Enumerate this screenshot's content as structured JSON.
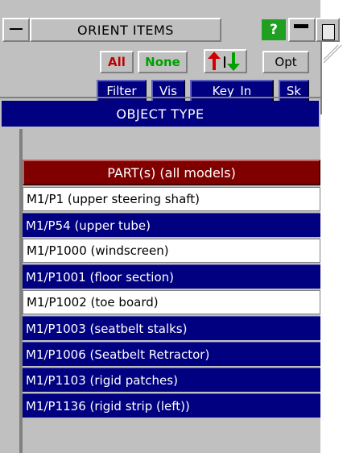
{
  "window": {
    "title": "ORIENT ITEMS",
    "help_label": "?"
  },
  "toolbar": {
    "all_label": "All",
    "none_label": "None",
    "opt_label": "Opt",
    "filter_label": "Filter",
    "vis_label": "Vis",
    "keyin_label": "Key_In",
    "sk_label": "Sk"
  },
  "colors": {
    "all_text": "#c00000",
    "none_text": "#00a000",
    "selected_bg": "#000080",
    "header_bg": "#800000",
    "help_bg": "#20a020"
  },
  "object_type": {
    "label": "OBJECT TYPE"
  },
  "list": {
    "header": "PART(s) (all models)",
    "items": [
      {
        "label": "M1/P1 (upper steering shaft)",
        "selected": false
      },
      {
        "label": "M1/P54 (upper tube)",
        "selected": true
      },
      {
        "label": "M1/P1000 (windscreen)",
        "selected": false
      },
      {
        "label": "M1/P1001 (floor section)",
        "selected": true
      },
      {
        "label": "M1/P1002 (toe board)",
        "selected": false
      },
      {
        "label": "M1/P1003 (seatbelt stalks)",
        "selected": true
      },
      {
        "label": "M1/P1006 (Seatbelt Retractor)",
        "selected": true
      },
      {
        "label": "M1/P1103 (rigid patches)",
        "selected": true
      },
      {
        "label": "M1/P1136 (rigid strip (left))",
        "selected": true
      }
    ]
  }
}
